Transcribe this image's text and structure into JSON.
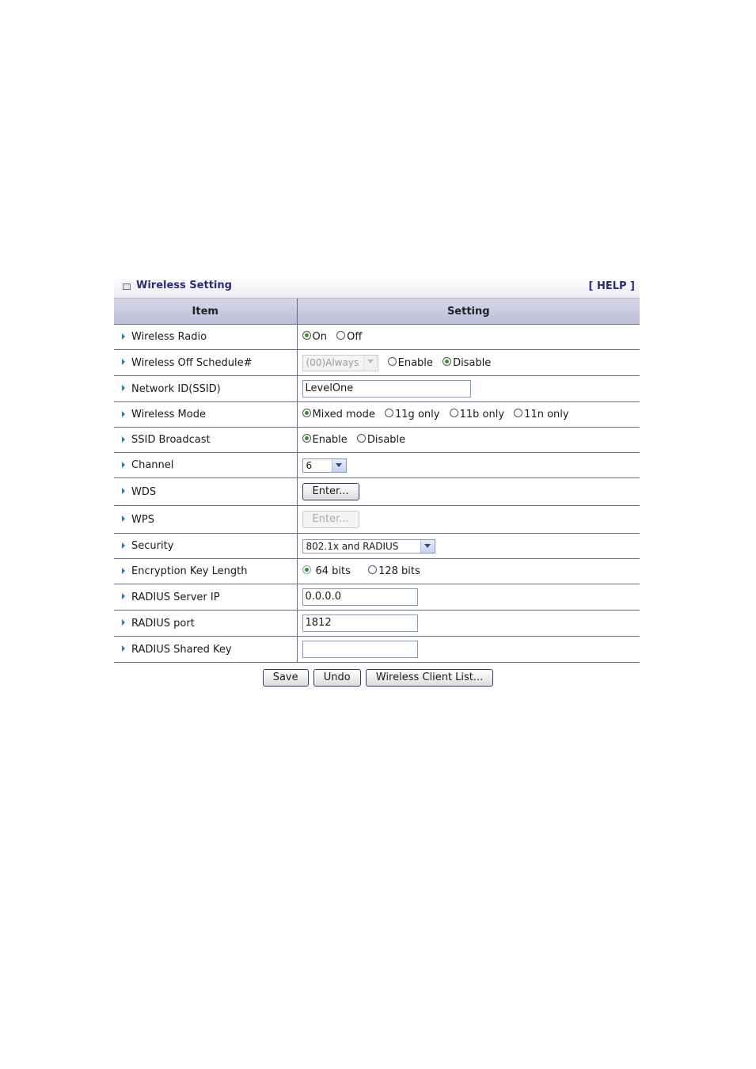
{
  "header": {
    "title": "Wireless Setting",
    "help": "[ HELP ]"
  },
  "columns": {
    "item": "Item",
    "setting": "Setting"
  },
  "rows": {
    "wireless_radio": {
      "label": "Wireless Radio",
      "opt_on": "On",
      "opt_off": "Off",
      "selected": "On"
    },
    "off_schedule": {
      "label": "Wireless Off Schedule#",
      "select_value": "(00)Always",
      "opt_enable": "Enable",
      "opt_disable": "Disable",
      "selected": "Disable"
    },
    "ssid": {
      "label": "Network ID(SSID)",
      "value": "LevelOne"
    },
    "mode": {
      "label": "Wireless Mode",
      "opt_mixed": "Mixed mode",
      "opt_11g": "11g only",
      "opt_11b": "11b only",
      "opt_11n": "11n only",
      "selected": "Mixed mode"
    },
    "ssid_broadcast": {
      "label": "SSID Broadcast",
      "opt_enable": "Enable",
      "opt_disable": "Disable",
      "selected": "Enable"
    },
    "channel": {
      "label": "Channel",
      "value": "6"
    },
    "wds": {
      "label": "WDS",
      "button": "Enter..."
    },
    "wps": {
      "label": "WPS",
      "button": "Enter..."
    },
    "security": {
      "label": "Security",
      "value": "802.1x and RADIUS"
    },
    "key_length": {
      "label": "Encryption Key Length",
      "opt_64": "64 bits",
      "opt_128": "128 bits",
      "selected": "64 bits"
    },
    "radius_ip": {
      "label": "RADIUS Server IP",
      "value": "0.0.0.0"
    },
    "radius_port": {
      "label": "RADIUS port",
      "value": "1812"
    },
    "radius_key": {
      "label": "RADIUS Shared Key",
      "value": ""
    }
  },
  "actions": {
    "save": "Save",
    "undo": "Undo",
    "client_list": "Wireless Client List..."
  },
  "colors": {
    "title_text": "#2b2b7a",
    "header_bg": "#c8c8e0",
    "arrow": "#1f7fb0",
    "radio_dot": "#2a9a2a",
    "grid_line": "#6b6b8a"
  }
}
